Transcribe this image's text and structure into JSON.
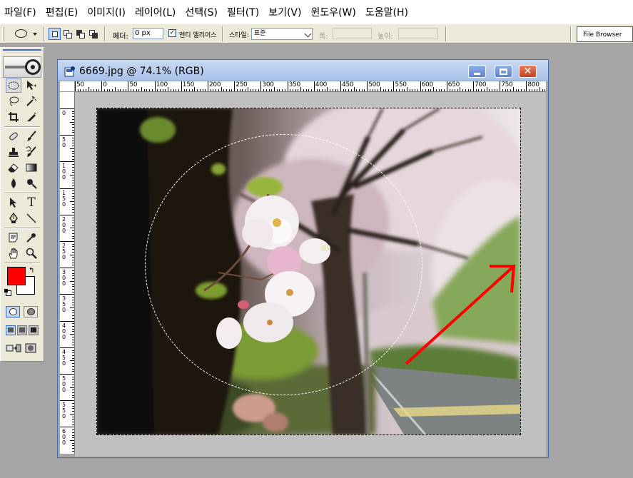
{
  "menu": [
    "파일(F)",
    "편집(E)",
    "이미지(I)",
    "레이어(L)",
    "선택(S)",
    "필터(T)",
    "보기(V)",
    "윈도우(W)",
    "도움말(H)"
  ],
  "options": {
    "feather_label": "페더:",
    "feather_value": "0 px",
    "antialias_checked": "✓",
    "antialias_label": "앤티 앨리어스",
    "style_label": "스타일:",
    "style_value": "표준",
    "width_label": "폭:",
    "height_label": "높이:",
    "file_browser_tab": "File Browser"
  },
  "toolbox": {
    "foreground_color": "#ff0000",
    "background_color": "#ffffff"
  },
  "document": {
    "title": "6669.jpg @ 74.1% (RGB)",
    "zoom": "74.1%",
    "h_ruler_labels": [
      "50",
      "0",
      "50",
      "100",
      "150",
      "200",
      "250",
      "300",
      "350",
      "400",
      "450",
      "500",
      "550",
      "600",
      "650",
      "700",
      "750",
      "800"
    ],
    "v_ruler_labels": [
      "0",
      "50",
      "100",
      "150",
      "200",
      "250",
      "300",
      "350",
      "400",
      "450",
      "500",
      "550",
      "600"
    ]
  },
  "colors": {
    "arrow": "#ff0000",
    "marching_ants": "#ffffff"
  }
}
